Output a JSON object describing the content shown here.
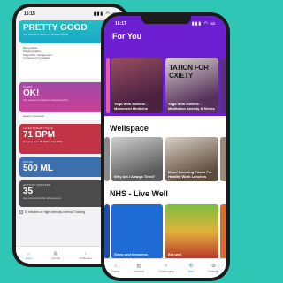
{
  "back_phone": {
    "time": "16:15",
    "signal": "▮▮▮ ◠ ▭",
    "mood_card": {
      "title": "PRETTY GOOD",
      "note": "You earned 1 points for answering this"
    },
    "mood_list": [
      "Being active",
      "Feeling healthy",
      "Supportive management",
      "In control of my health"
    ],
    "sleep_card": {
      "label": "Sleep",
      "value": "OK!",
      "note": "You earned 1 points for answering this"
    },
    "sleep_footer": "Haven't exercised",
    "heart_card": {
      "label": "Latest heart rate",
      "value": "71 BPM",
      "note": "Ranging from 58 BPM to 92 BPM"
    },
    "water_card": {
      "label": "Water",
      "value": "500 ML"
    },
    "activity_card": {
      "label": "Activity minutes",
      "value": "35",
      "note": "Get more points for what you do"
    },
    "hiit": {
      "count": "0",
      "text": "minutes of High Intensity Interval Training"
    },
    "tabs": [
      {
        "icon": "⌂",
        "label": "Home",
        "active": true
      },
      {
        "icon": "▤",
        "label": "Journal",
        "active": false
      },
      {
        "icon": "♀",
        "label": "Challenges",
        "active": false
      },
      {
        "icon": "✣",
        "label": "Hub",
        "active": false
      }
    ]
  },
  "front_phone": {
    "time": "16:17",
    "signal": "▮▮▮ ◠ ▭",
    "for_you": {
      "title": "For You",
      "items": [
        {
          "title": "Yoga With Adriene - Movement Medicine"
        },
        {
          "title": "Yoga With Adriene - Meditation Anxiety & Stress",
          "banner": "TATION FOR CXIETY"
        }
      ]
    },
    "wellspace": {
      "title": "Wellspace",
      "items": [
        {
          "title": "Why Am I Always Tired?"
        },
        {
          "title": "Mood Boosting Foods For Healthy Work Lunches"
        }
      ]
    },
    "nhs": {
      "title": "NHS - Live Well",
      "items": [
        {
          "title": "Sleep and tiredness"
        },
        {
          "title": "Eat well"
        }
      ]
    },
    "tabs": [
      {
        "icon": "⌂",
        "label": "Home",
        "active": false
      },
      {
        "icon": "▤",
        "label": "Journal",
        "active": false
      },
      {
        "icon": "♀",
        "label": "Challenges",
        "active": false
      },
      {
        "icon": "✣",
        "label": "Hub",
        "active": true
      },
      {
        "icon": "⚙",
        "label": "Settings",
        "active": false
      }
    ]
  },
  "colors": {
    "background": "#2fc6b5",
    "purple_header": "#6b1fd1",
    "accent_tab": "#2aa0c8"
  }
}
